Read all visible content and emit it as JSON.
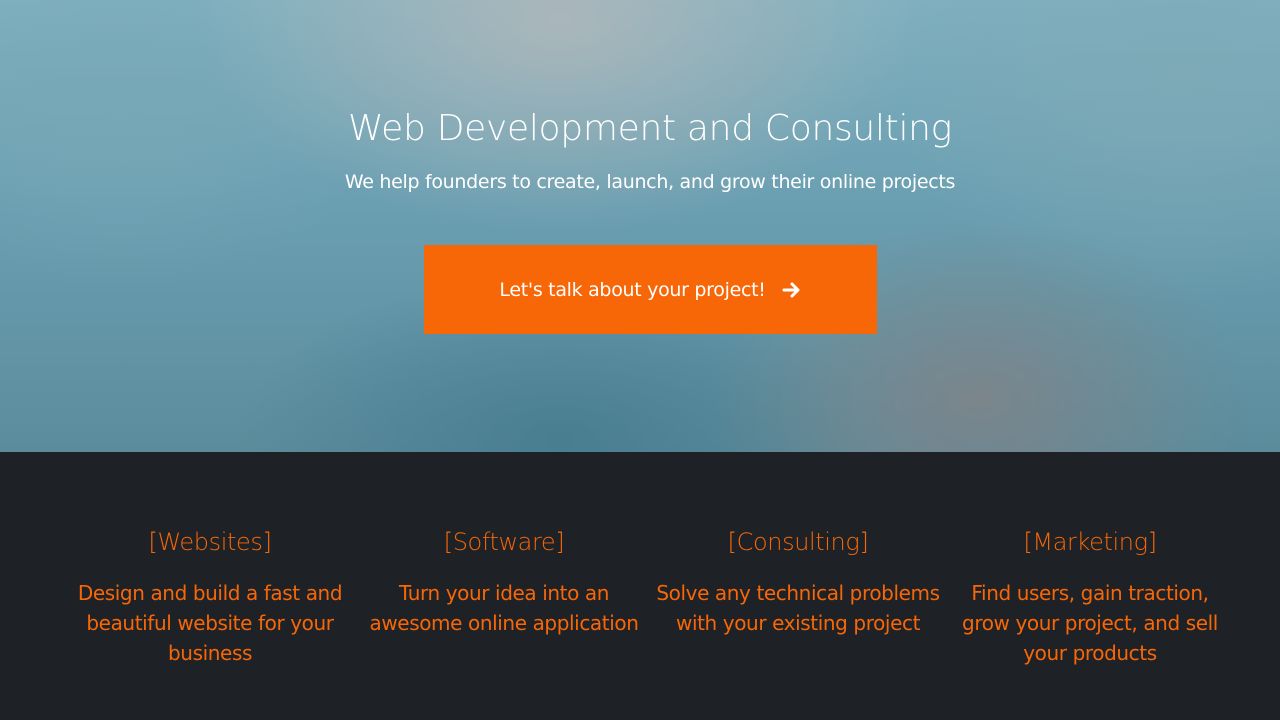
{
  "hero": {
    "title": "Web Development and Consulting",
    "subtitle": "We help founders to create, launch, and grow their online projects",
    "cta_label": "Let's talk about your project!",
    "cta_icon": "arrow-right-icon"
  },
  "services": [
    {
      "title": "[Websites]",
      "description": "Design and build a fast and beautiful website for your business"
    },
    {
      "title": "[Software]",
      "description": "Turn your idea into an awesome online application"
    },
    {
      "title": "[Consulting]",
      "description": "Solve any technical problems with your existing project"
    },
    {
      "title": "[Marketing]",
      "description": "Find users, gain traction, grow your project, and sell your products"
    }
  ],
  "colors": {
    "accent": "#f76707",
    "dark_background": "#1e2227",
    "hero_text": "#ffffff"
  }
}
